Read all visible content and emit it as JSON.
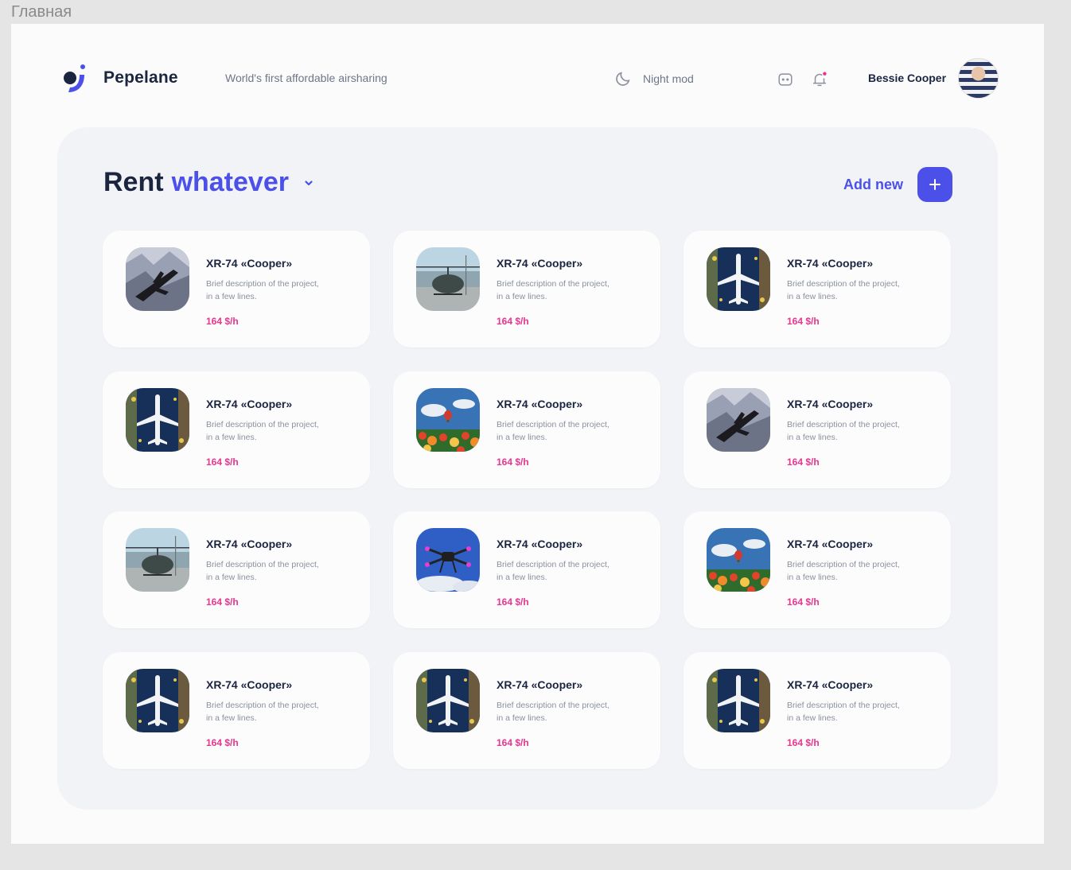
{
  "frame_label": "Главная",
  "header": {
    "brand": "Pepelane",
    "tagline": "World's first affordable airsharing",
    "night_mode_label": "Night mod",
    "user_name": "Bessie Cooper",
    "accent_color": "#4a50e8",
    "notification_dot_color": "#e6368e"
  },
  "panel": {
    "title_main": "Rent",
    "title_accent": "whatever",
    "add_new_label": "Add new"
  },
  "cards": [
    {
      "title": "XR-74 «Cooper»",
      "desc_line1": "Brief description of the project,",
      "desc_line2": "in a few lines.",
      "price": "164 $/h",
      "image": "jet"
    },
    {
      "title": "XR-74 «Cooper»",
      "desc_line1": "Brief description of the project,",
      "desc_line2": "in a few lines.",
      "price": "164 $/h",
      "image": "helicopter"
    },
    {
      "title": "XR-74 «Cooper»",
      "desc_line1": "Brief description of the project,",
      "desc_line2": "in a few lines.",
      "price": "164 $/h",
      "image": "airliner"
    },
    {
      "title": "XR-74 «Cooper»",
      "desc_line1": "Brief description of the project,",
      "desc_line2": "in a few lines.",
      "price": "164 $/h",
      "image": "airliner"
    },
    {
      "title": "XR-74 «Cooper»",
      "desc_line1": "Brief description of the project,",
      "desc_line2": "in a few lines.",
      "price": "164 $/h",
      "image": "balloon"
    },
    {
      "title": "XR-74 «Cooper»",
      "desc_line1": "Brief description of the project,",
      "desc_line2": "in a few lines.",
      "price": "164 $/h",
      "image": "jet"
    },
    {
      "title": "XR-74 «Cooper»",
      "desc_line1": "Brief description of the project,",
      "desc_line2": "in a few lines.",
      "price": "164 $/h",
      "image": "helicopter"
    },
    {
      "title": "XR-74 «Cooper»",
      "desc_line1": "Brief description of the project,",
      "desc_line2": "in a few lines.",
      "price": "164 $/h",
      "image": "drone"
    },
    {
      "title": "XR-74 «Cooper»",
      "desc_line1": "Brief description of the project,",
      "desc_line2": "in a few lines.",
      "price": "164 $/h",
      "image": "balloon"
    },
    {
      "title": "XR-74 «Cooper»",
      "desc_line1": "Brief description of the project,",
      "desc_line2": "in a few lines.",
      "price": "164 $/h",
      "image": "airliner"
    },
    {
      "title": "XR-74 «Cooper»",
      "desc_line1": "Brief description of the project,",
      "desc_line2": "in a few lines.",
      "price": "164 $/h",
      "image": "airliner"
    },
    {
      "title": "XR-74 «Cooper»",
      "desc_line1": "Brief description of the project,",
      "desc_line2": "in a few lines.",
      "price": "164 $/h",
      "image": "airliner"
    }
  ]
}
